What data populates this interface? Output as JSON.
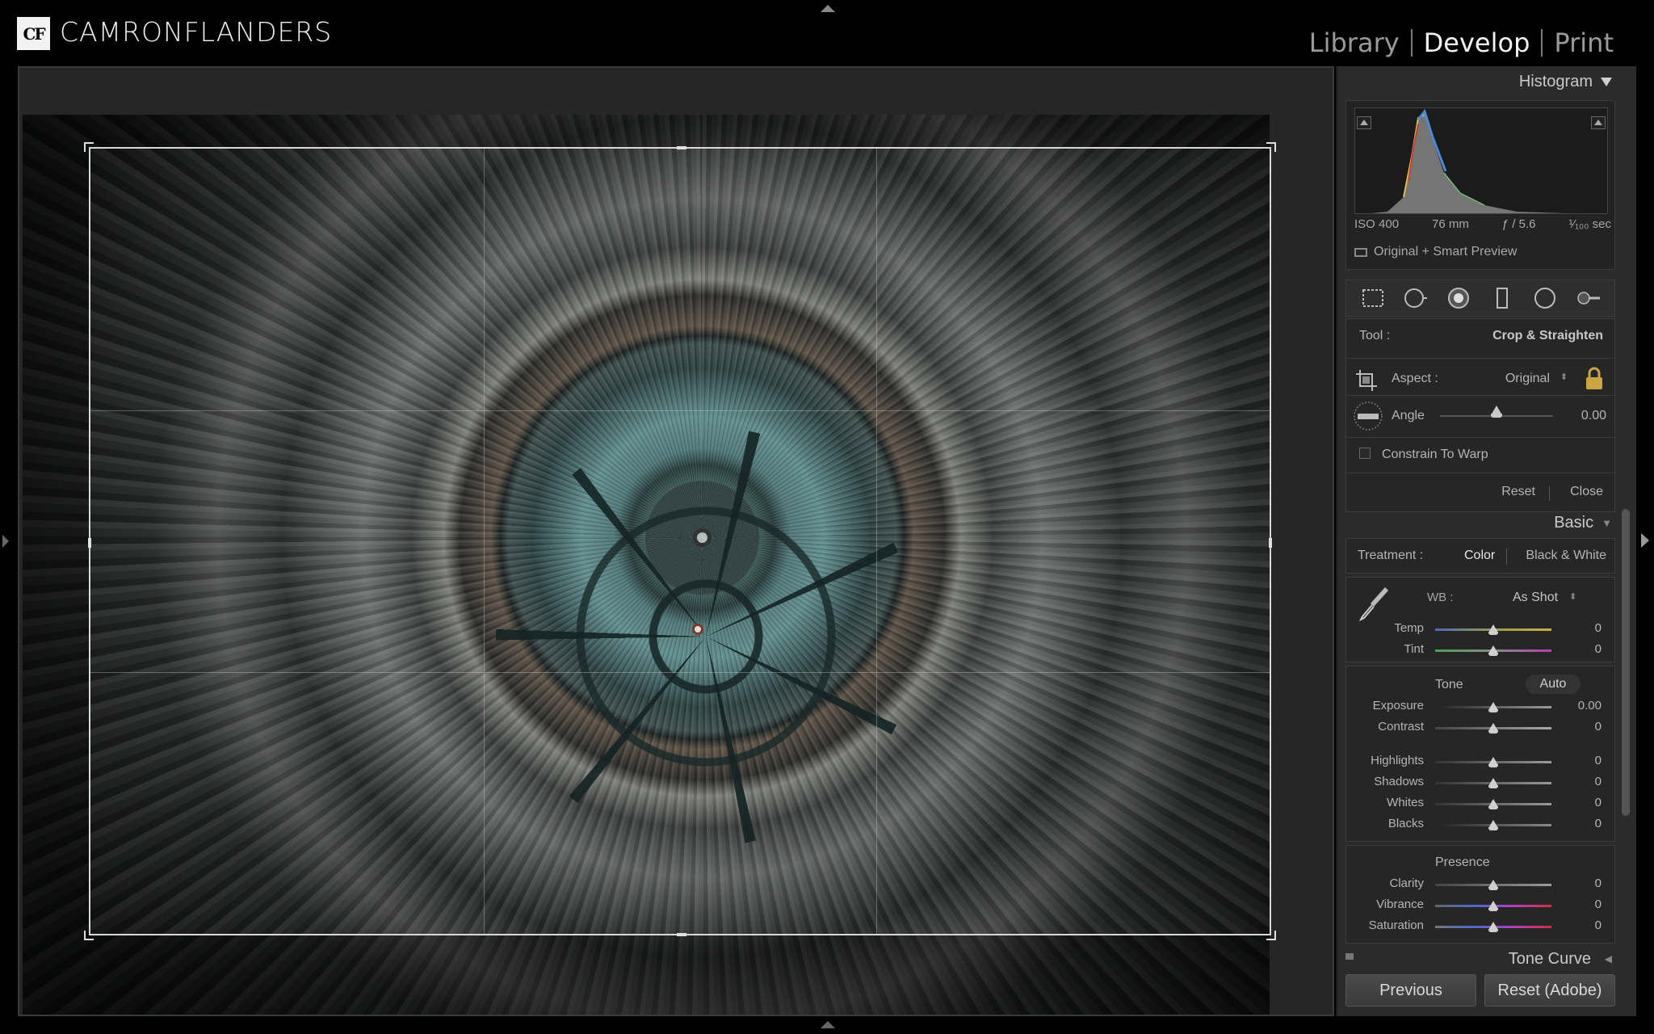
{
  "app": {
    "logo_mark": "CF",
    "logo_text": "CAMRONFLANDERS"
  },
  "modules": [
    {
      "label": "Library",
      "active": false
    },
    {
      "label": "Develop",
      "active": true
    },
    {
      "label": "Print",
      "active": false
    }
  ],
  "histogram": {
    "title": "Histogram",
    "iso": "ISO 400",
    "focal": "76 mm",
    "aperture": "ƒ / 5.6",
    "shutter": "¹⁄₁₀₀ sec",
    "preview": "Original + Smart Preview"
  },
  "crop": {
    "tool_label": "Tool :",
    "tool_value": "Crop & Straighten",
    "aspect_label": "Aspect :",
    "aspect_value": "Original",
    "angle_label": "Angle",
    "angle_value": "0.00",
    "angle_position": 0.5,
    "constrain_label": "Constrain To Warp",
    "reset": "Reset",
    "close": "Close"
  },
  "basic": {
    "title": "Basic",
    "treatment_label": "Treatment :",
    "treatment_color": "Color",
    "treatment_bw": "Black & White",
    "wb_label": "WB :",
    "wb_value": "As Shot",
    "temp_label": "Temp",
    "temp_value": "0",
    "tint_label": "Tint",
    "tint_value": "0",
    "tone_label": "Tone",
    "auto": "Auto",
    "exposure_label": "Exposure",
    "exposure_value": "0.00",
    "contrast_label": "Contrast",
    "contrast_value": "0",
    "highlights_label": "Highlights",
    "highlights_value": "0",
    "shadows_label": "Shadows",
    "shadows_value": "0",
    "whites_label": "Whites",
    "whites_value": "0",
    "blacks_label": "Blacks",
    "blacks_value": "0",
    "presence_label": "Presence",
    "clarity_label": "Clarity",
    "clarity_value": "0",
    "vibrance_label": "Vibrance",
    "vibrance_value": "0",
    "saturation_label": "Saturation",
    "saturation_value": "0"
  },
  "tone_curve": {
    "title": "Tone Curve"
  },
  "buttons": {
    "previous": "Previous",
    "reset": "Reset (Adobe)"
  },
  "colors": {
    "background": "#000000",
    "panel": "#2b2b2b",
    "canvas": "#262626",
    "text": "#cfcfcf",
    "active_module": "#f2f2f2",
    "lock": "#c9a640"
  }
}
